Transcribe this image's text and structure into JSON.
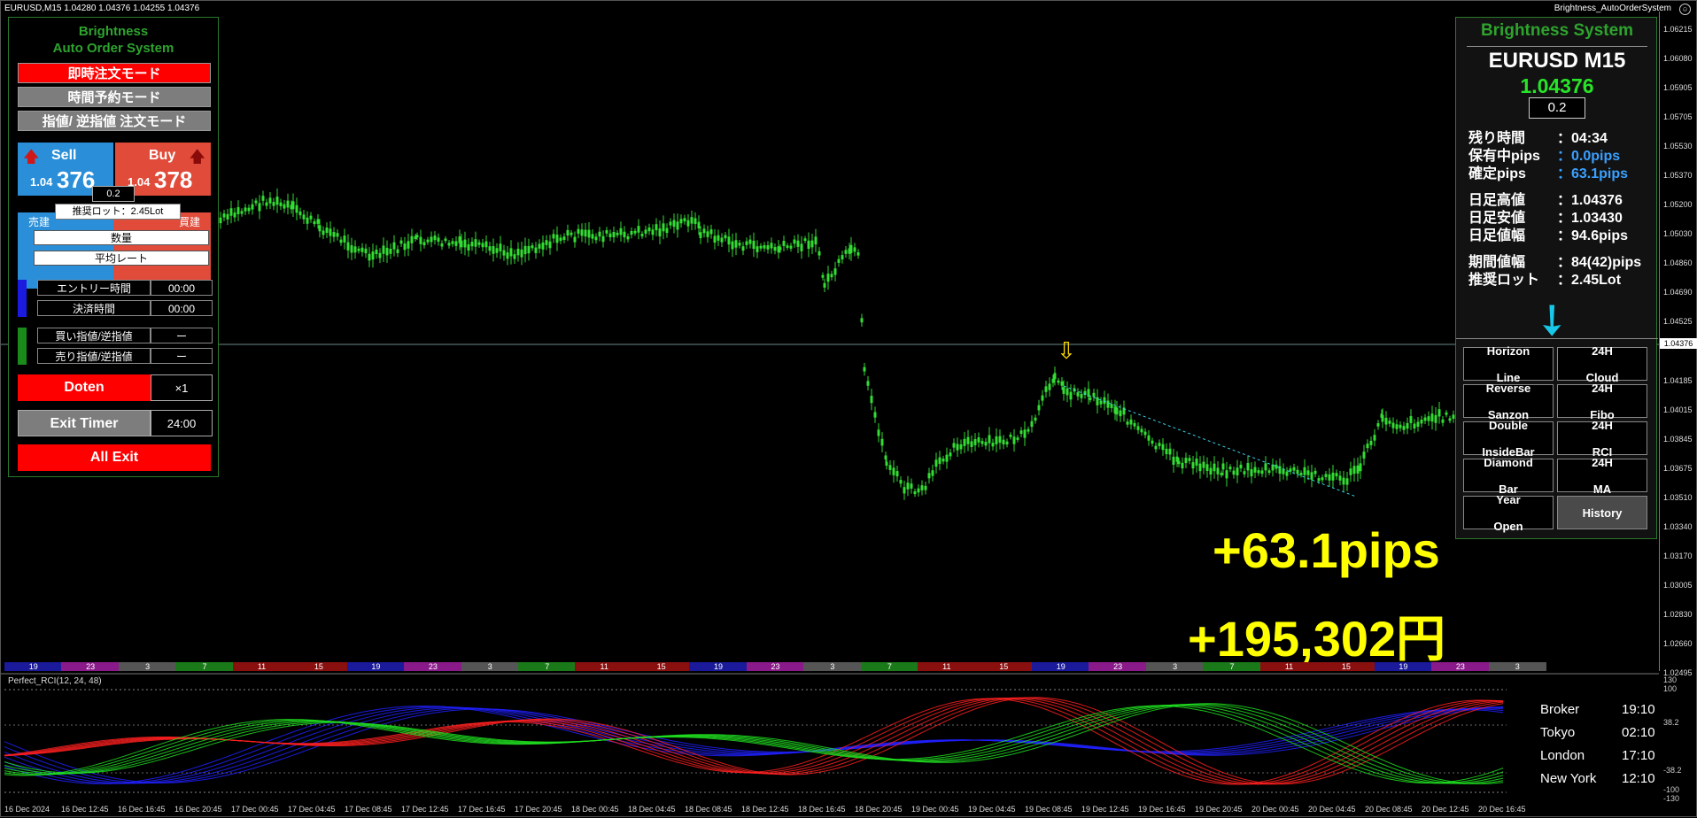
{
  "window": {
    "title": "EURUSD,M15  1.04280 1.04376 1.04255 1.04376",
    "ea_name": "Brightness_AutoOrderSystem"
  },
  "price_axis": {
    "labels": [
      "1.06215",
      "1.06080",
      "1.05905",
      "1.05705",
      "1.05530",
      "1.05370",
      "1.05200",
      "1.05030",
      "1.04860",
      "1.04690",
      "1.04525",
      "1.04376",
      "1.04185",
      "1.04015",
      "1.03845",
      "1.03675",
      "1.03510",
      "1.03340",
      "1.03170",
      "1.03005",
      "1.02830",
      "1.02660",
      "1.02495"
    ],
    "current": "1.04376"
  },
  "left_panel": {
    "title_line1": "Brightness",
    "title_line2": "Auto Order System",
    "mode_instant": "即時注文モード",
    "mode_time": "時間予約モード",
    "mode_limit": "指値/ 逆指値 注文モード",
    "sell_label": "Sell",
    "sell_price_small": "1.04",
    "sell_price_big": "376",
    "buy_label": "Buy",
    "buy_price_small": "1.04",
    "buy_price_big": "378",
    "lot": "0.2",
    "lot_tooltip": "推奨ロット：2.45Lot",
    "sell_tag": "売建",
    "buy_tag": "買建",
    "qty_label": "数量",
    "avg_rate_label": "平均レート",
    "entry_time_label": "エントリー時間",
    "entry_time_value": "00:00",
    "exit_time_label": "決済時間",
    "exit_time_value": "00:00",
    "buy_limit_label": "買い指値/逆指値",
    "buy_limit_value": "ー",
    "sell_limit_label": "売り指値/逆指値",
    "sell_limit_value": "ー",
    "doten_label": "Doten",
    "doten_value": "×1",
    "exit_timer_label": "Exit Timer",
    "exit_timer_value": "24:00",
    "all_exit_label": "All Exit"
  },
  "right_panel": {
    "title": "Brightness System",
    "symbol": "EURUSD  M15",
    "price": "1.04376",
    "spread": "0.2",
    "rows1": [
      {
        "key": "残り時間",
        "value": "：04:34",
        "color": "#ffffff"
      },
      {
        "key": "保有中pips",
        "value": "：0.0pips",
        "color": "#3aa0ff"
      },
      {
        "key": "確定pips",
        "value": "：63.1pips",
        "color": "#3aa0ff"
      }
    ],
    "rows2": [
      {
        "key": "日足高値",
        "value": "：1.04376",
        "color": "#ffffff"
      },
      {
        "key": "日足安値",
        "value": "：1.03430",
        "color": "#ffffff"
      },
      {
        "key": "日足値幅",
        "value": "：94.6pips",
        "color": "#ffffff"
      }
    ],
    "rows3": [
      {
        "key": "期間値幅",
        "value": "：84(42)pips",
        "color": "#ffffff"
      },
      {
        "key": "推奨ロット",
        "value": "：2.45Lot",
        "color": "#ffffff"
      }
    ],
    "buttons": [
      {
        "line1": "Horizon",
        "line2": "Line"
      },
      {
        "line1": "24H",
        "line2": "Cloud"
      },
      {
        "line1": "Reverse",
        "line2": "Sanzon"
      },
      {
        "line1": "24H",
        "line2": "Fibo"
      },
      {
        "line1": "Double",
        "line2": "InsideBar"
      },
      {
        "line1": "24H",
        "line2": "RCI"
      },
      {
        "line1": "Diamond",
        "line2": "Bar"
      },
      {
        "line1": "24H",
        "line2": "MA"
      },
      {
        "line1": "Year",
        "line2": "Open"
      },
      {
        "line1": "History",
        "line2": ""
      }
    ]
  },
  "overlay": {
    "pips_result": "+63.1pips",
    "yen_result": "+195,302円"
  },
  "session_bar": {
    "labels": [
      "19",
      "23",
      "3",
      "7",
      "11",
      "15",
      "19",
      "23",
      "3",
      "7",
      "11",
      "15",
      "19",
      "23",
      "3",
      "7",
      "11",
      "15",
      "19",
      "23",
      "3",
      "7",
      "11",
      "15",
      "19",
      "23",
      "3"
    ],
    "colors": {
      "asia": "#1a1a9a",
      "europe": "#8a1010",
      "ny": "#8a1a8a",
      "gap": "#555555",
      "green": "#1a7a1a"
    }
  },
  "indicator": {
    "title": "Perfect_RCI(12, 24, 48)",
    "levels": [
      "130",
      "100",
      "38.2",
      "-38.2",
      "-100",
      "-130"
    ],
    "line_colors": {
      "short": "#ff2020",
      "mid": "#20e020",
      "long": "#2020ff"
    }
  },
  "clocks": [
    {
      "city": "Broker",
      "time": "19:10"
    },
    {
      "city": "Tokyo",
      "time": "02:10"
    },
    {
      "city": "London",
      "time": "17:10"
    },
    {
      "city": "New York",
      "time": "12:10"
    }
  ],
  "time_axis": [
    "16 Dec 2024",
    "16 Dec 12:45",
    "16 Dec 16:45",
    "16 Dec 20:45",
    "17 Dec 00:45",
    "17 Dec 04:45",
    "17 Dec 08:45",
    "17 Dec 12:45",
    "17 Dec 16:45",
    "17 Dec 20:45",
    "18 Dec 00:45",
    "18 Dec 04:45",
    "18 Dec 08:45",
    "18 Dec 12:45",
    "18 Dec 16:45",
    "18 Dec 20:45",
    "19 Dec 00:45",
    "19 Dec 04:45",
    "19 Dec 08:45",
    "19 Dec 12:45",
    "19 Dec 16:45",
    "19 Dec 20:45",
    "20 Dec 00:45",
    "20 Dec 04:45",
    "20 Dec 08:45",
    "20 Dec 12:45",
    "20 Dec 16:45"
  ]
}
